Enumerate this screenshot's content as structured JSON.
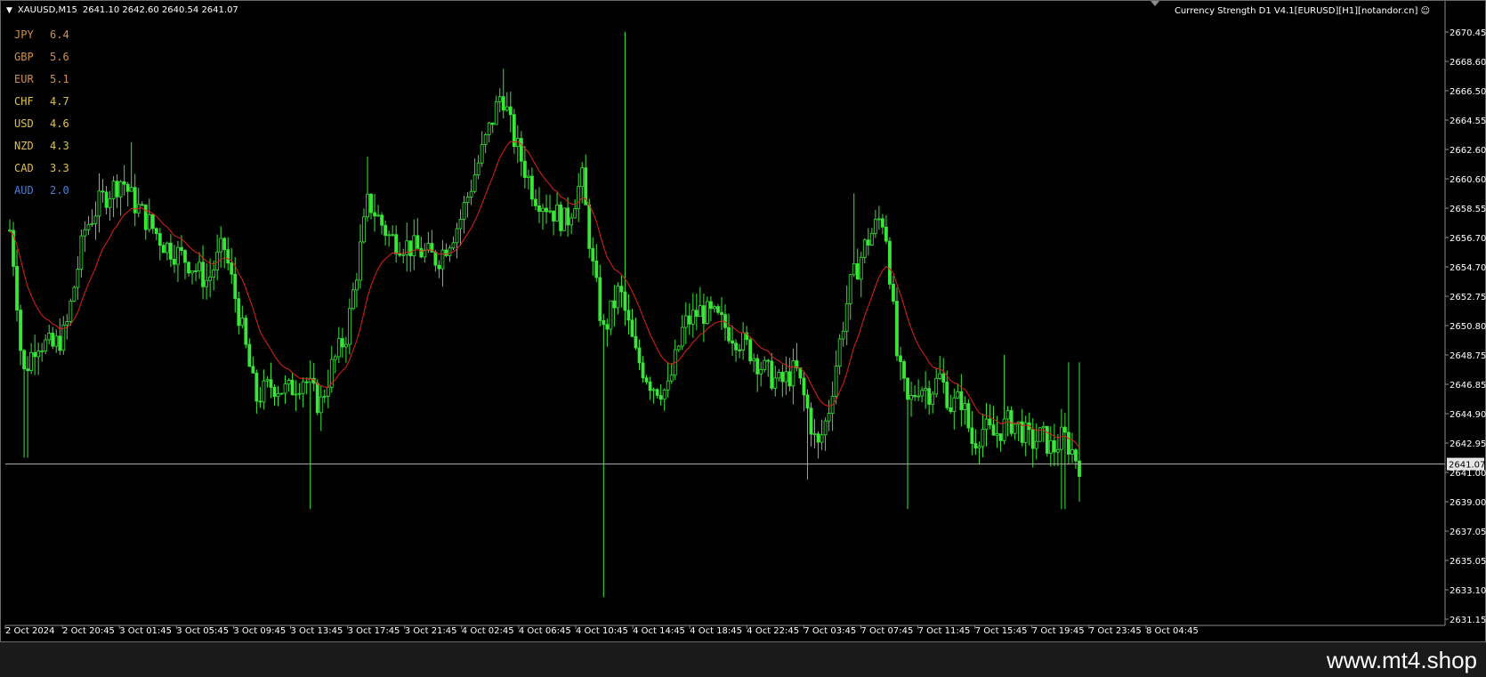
{
  "chart_header": {
    "symbol": "XAUUSD,M15",
    "ohlc": "2641.10 2642.60 2640.54 2641.07",
    "indicator": "Currency Strength D1 V4.1[EURUSD][H1][notandor.cn]",
    "indicator_icon": "smiley-icon"
  },
  "currency_strength": [
    {
      "code": "JPY",
      "value": "6.4",
      "color": "#d2904a"
    },
    {
      "code": "GBP",
      "value": "5.6",
      "color": "#d2904a"
    },
    {
      "code": "EUR",
      "value": "5.1",
      "color": "#d2904a"
    },
    {
      "code": "CHF",
      "value": "4.7",
      "color": "#e0c24a"
    },
    {
      "code": "USD",
      "value": "4.6",
      "color": "#e0c24a"
    },
    {
      "code": "NZD",
      "value": "4.3",
      "color": "#e0c24a"
    },
    {
      "code": "CAD",
      "value": "3.3",
      "color": "#e0c24a"
    },
    {
      "code": "AUD",
      "value": "2.0",
      "color": "#4a7fd6"
    }
  ],
  "watermark": "www.mt4.shop",
  "colors": {
    "candles": "#39e639",
    "moving_average": "#e01f1f",
    "price_line": "#b0b0b0",
    "axis_text": "#ffffff",
    "background": "#000000"
  },
  "chart_data": {
    "type": "candlestick",
    "symbol": "XAUUSD",
    "timeframe": "M15",
    "current_price": 2641.07,
    "current_price_label": "2641.07",
    "ylim": [
      2630.2,
      2671.4
    ],
    "y_ticks": [
      "2670.45",
      "2668.60",
      "2666.50",
      "2664.55",
      "2662.60",
      "2660.60",
      "2658.55",
      "2656.70",
      "2654.70",
      "2652.75",
      "2650.80",
      "2648.75",
      "2646.85",
      "2644.90",
      "2642.95",
      "2641.00",
      "2639.00",
      "2637.05",
      "2635.05",
      "2633.10",
      "2631.15"
    ],
    "x_ticks": [
      "2 Oct 2024",
      "2 Oct 20:45",
      "3 Oct 01:45",
      "3 Oct 05:45",
      "3 Oct 09:45",
      "3 Oct 13:45",
      "3 Oct 17:45",
      "3 Oct 21:45",
      "4 Oct 02:45",
      "4 Oct 06:45",
      "4 Oct 10:45",
      "4 Oct 14:45",
      "4 Oct 18:45",
      "4 Oct 22:45",
      "7 Oct 03:45",
      "7 Oct 07:45",
      "7 Oct 11:45",
      "7 Oct 15:45",
      "7 Oct 19:45",
      "7 Oct 23:45",
      "8 Oct 04:45"
    ],
    "price_path": [
      [
        0,
        2657.0
      ],
      [
        0.005,
        2654.0
      ],
      [
        0.012,
        2647.0
      ],
      [
        0.025,
        2649.5
      ],
      [
        0.04,
        2649.0
      ],
      [
        0.052,
        2650.0
      ],
      [
        0.07,
        2657.0
      ],
      [
        0.085,
        2659.0
      ],
      [
        0.105,
        2660.5
      ],
      [
        0.115,
        2659.0
      ],
      [
        0.13,
        2657.5
      ],
      [
        0.145,
        2656.0
      ],
      [
        0.165,
        2655.0
      ],
      [
        0.185,
        2653.5
      ],
      [
        0.2,
        2656.0
      ],
      [
        0.215,
        2651.0
      ],
      [
        0.23,
        2645.5
      ],
      [
        0.245,
        2646.5
      ],
      [
        0.26,
        2646.0
      ],
      [
        0.275,
        2647.0
      ],
      [
        0.29,
        2645.0
      ],
      [
        0.3,
        2647.5
      ],
      [
        0.315,
        2650.0
      ],
      [
        0.335,
        2659.0
      ],
      [
        0.355,
        2656.5
      ],
      [
        0.37,
        2656.0
      ],
      [
        0.385,
        2655.5
      ],
      [
        0.4,
        2655.0
      ],
      [
        0.42,
        2657.5
      ],
      [
        0.44,
        2662.0
      ],
      [
        0.46,
        2666.5
      ],
      [
        0.47,
        2663.5
      ],
      [
        0.49,
        2659.5
      ],
      [
        0.505,
        2658.5
      ],
      [
        0.52,
        2657.5
      ],
      [
        0.535,
        2660.5
      ],
      [
        0.545,
        2654.5
      ],
      [
        0.555,
        2650.0
      ],
      [
        0.57,
        2653.0
      ],
      [
        0.585,
        2648.5
      ],
      [
        0.6,
        2646.5
      ],
      [
        0.615,
        2646.0
      ],
      [
        0.63,
        2650.5
      ],
      [
        0.645,
        2651.5
      ],
      [
        0.66,
        2651.0
      ],
      [
        0.675,
        2650.0
      ],
      [
        0.69,
        2649.0
      ],
      [
        0.705,
        2647.5
      ],
      [
        0.72,
        2646.5
      ],
      [
        0.735,
        2647.5
      ],
      [
        0.745,
        2645.0
      ],
      [
        0.755,
        2642.0
      ],
      [
        0.765,
        2644.5
      ],
      [
        0.775,
        2649.0
      ],
      [
        0.785,
        2653.0
      ],
      [
        0.8,
        2656.0
      ],
      [
        0.815,
        2658.0
      ],
      [
        0.82,
        2656.5
      ],
      [
        0.83,
        2648.0
      ],
      [
        0.84,
        2645.0
      ],
      [
        0.85,
        2646.5
      ],
      [
        0.86,
        2646.0
      ],
      [
        0.87,
        2647.0
      ],
      [
        0.88,
        2645.0
      ],
      [
        0.89,
        2645.5
      ],
      [
        0.9,
        2642.5
      ],
      [
        0.91,
        2643.5
      ],
      [
        0.92,
        2643.0
      ],
      [
        0.935,
        2644.0
      ],
      [
        0.945,
        2643.5
      ],
      [
        0.955,
        2642.5
      ],
      [
        0.965,
        2643.0
      ],
      [
        0.975,
        2642.0
      ],
      [
        0.985,
        2643.0
      ],
      [
        1.0,
        2641.1
      ]
    ],
    "wick_highs": [
      [
        0.115,
        2663.0
      ],
      [
        0.335,
        2662.0
      ],
      [
        0.46,
        2668.0
      ],
      [
        0.575,
        2670.5
      ],
      [
        0.79,
        2659.5
      ],
      [
        0.93,
        2648.5
      ],
      [
        0.99,
        2648.0
      ]
    ],
    "wick_lows": [
      [
        0.015,
        2641.5
      ],
      [
        0.28,
        2638.0
      ],
      [
        0.555,
        2632.0
      ],
      [
        0.745,
        2640.0
      ],
      [
        0.84,
        2638.0
      ],
      [
        0.985,
        2638.0
      ]
    ]
  }
}
